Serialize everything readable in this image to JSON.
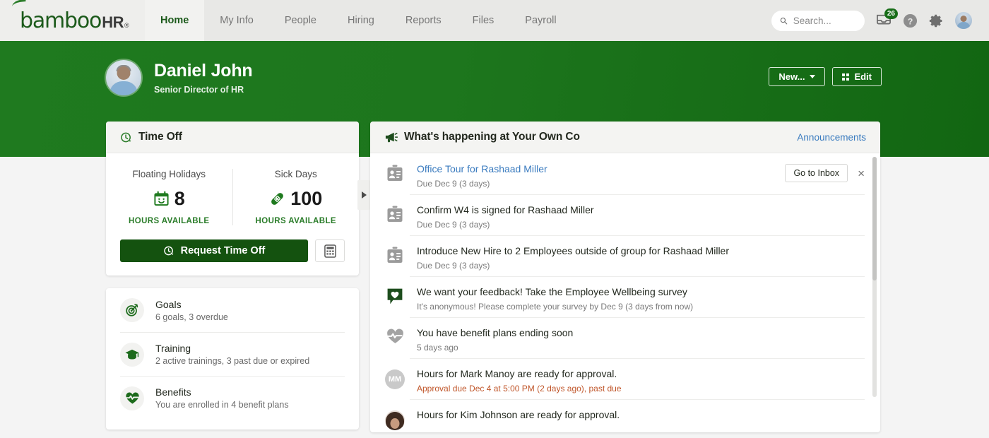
{
  "brand": {
    "logo_text": "bamboo",
    "logo_suffix": "HR",
    "logo_registered": "®",
    "green": "#1f7a1f",
    "dark_green": "#14520f",
    "link_blue": "#3a7bbf",
    "overdue_orange": "#c0562a"
  },
  "nav": {
    "tabs": [
      {
        "label": "Home",
        "active": true
      },
      {
        "label": "My Info",
        "active": false
      },
      {
        "label": "People",
        "active": false
      },
      {
        "label": "Hiring",
        "active": false
      },
      {
        "label": "Reports",
        "active": false
      },
      {
        "label": "Files",
        "active": false
      },
      {
        "label": "Payroll",
        "active": false
      }
    ],
    "search_placeholder": "Search...",
    "inbox_badge": "26",
    "icons": [
      "inbox-icon",
      "help-icon",
      "settings-gear-icon",
      "user-avatar"
    ]
  },
  "profile": {
    "name": "Daniel John",
    "title": "Senior Director of HR",
    "new_button": "New...",
    "edit_button": "Edit"
  },
  "time_off": {
    "card_title": "Time Off",
    "balances": [
      {
        "label": "Floating Holidays",
        "value": "8",
        "unit": "HOURS AVAILABLE",
        "icon": "calendar-smile-icon"
      },
      {
        "label": "Sick Days",
        "value": "100",
        "unit": "HOURS AVAILABLE",
        "icon": "bandage-icon"
      }
    ],
    "request_button": "Request Time Off",
    "calculator_icon": "calculator-icon",
    "next_arrow": "chevron-right-icon"
  },
  "quick_links": [
    {
      "icon": "target-goal-icon",
      "title": "Goals",
      "subtitle": "6 goals, 3 overdue"
    },
    {
      "icon": "graduation-cap-icon",
      "title": "Training",
      "subtitle": "2 active trainings, 3 past due or expired"
    },
    {
      "icon": "heart-pulse-icon",
      "title": "Benefits",
      "subtitle": "You are enrolled in 4 benefit plans"
    }
  ],
  "feed": {
    "card_title": "What's happening at Your Own Co",
    "announcements_link": "Announcements",
    "megaphone_icon": "megaphone-icon",
    "items": [
      {
        "icon": "id-badge-icon",
        "title": "Office Tour for Rashaad Miller",
        "is_link": true,
        "subtitle": "Due Dec 9 (3 days)",
        "overdue": false,
        "action_button": "Go to Inbox",
        "dismiss": "×"
      },
      {
        "icon": "id-badge-icon",
        "title": "Confirm W4 is signed for Rashaad Miller",
        "is_link": false,
        "subtitle": "Due Dec 9 (3 days)",
        "overdue": false
      },
      {
        "icon": "id-badge-icon",
        "title": "Introduce New Hire to 2 Employees outside of group for Rashaad Miller",
        "is_link": false,
        "subtitle": "Due Dec 9 (3 days)",
        "overdue": false
      },
      {
        "icon": "survey-heart-bubble-icon",
        "title": "We want your feedback! Take the Employee Wellbeing survey",
        "is_link": false,
        "subtitle": "It's anonymous! Please complete your survey by Dec 9 (3 days from now)",
        "overdue": false
      },
      {
        "icon": "heart-pulse-gray-icon",
        "title": "You have benefit plans ending soon",
        "is_link": false,
        "subtitle": "5 days ago",
        "overdue": false
      },
      {
        "icon": "initials-avatar",
        "initials": "MM",
        "title": "Hours for Mark Manoy are ready for approval.",
        "is_link": false,
        "subtitle": "Approval due Dec 4 at 5:00 PM (2 days ago), past due",
        "overdue": true
      },
      {
        "icon": "photo-avatar",
        "title": "Hours for Kim Johnson are ready for approval.",
        "is_link": false,
        "subtitle": "",
        "overdue": false
      }
    ]
  }
}
